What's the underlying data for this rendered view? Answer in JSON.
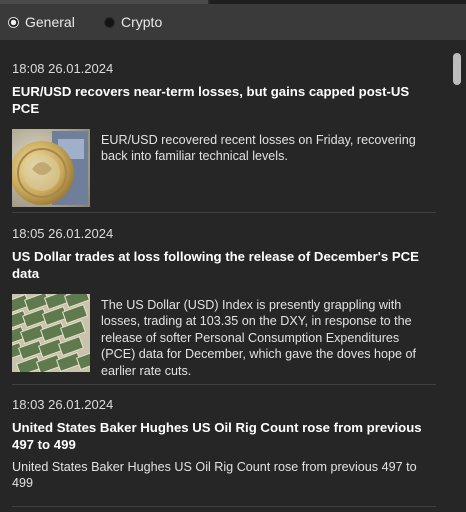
{
  "tabs": [
    {
      "label": "General",
      "selected": true
    },
    {
      "label": "Crypto",
      "selected": false
    }
  ],
  "news": [
    {
      "time": "18:08 26.01.2024",
      "title": "EUR/USD recovers near-term losses, but gains capped post-US PCE",
      "summary": "EUR/USD recovered recent losses on Friday, recovering back into familiar technical levels.",
      "image": "euro-coin"
    },
    {
      "time": "18:05 26.01.2024",
      "title": "US Dollar trades at loss following the release of December's PCE data",
      "summary": "The US Dollar (USD) Index is presently grappling with losses, trading at 103.35 on the DXY, in response to the release of softer Personal Consumption Expenditures (PCE) data for December, which gave the doves hope of earlier rate cuts.",
      "image": "dollar-bills"
    },
    {
      "time": "18:03 26.01.2024",
      "title": "United States Baker Hughes US Oil Rig Count rose from previous 497 to 499",
      "summary": "United States Baker Hughes US Oil Rig Count rose from previous 497 to 499"
    }
  ]
}
